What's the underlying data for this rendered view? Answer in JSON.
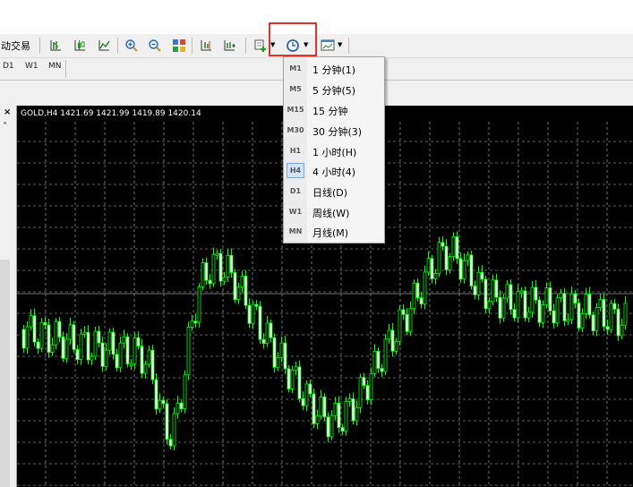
{
  "toolbar": {
    "trade_label": "动交易",
    "period_dropdown_icon": "clock-icon"
  },
  "timeframes_bar": [
    "D1",
    "W1",
    "MN"
  ],
  "chart": {
    "title": "GOLD,H4  1421.69 1421.99 1419.89 1420.14",
    "background": "#000000",
    "candle_color": "#00ff00"
  },
  "period_menu": {
    "items": [
      {
        "code": "M1",
        "label": "1 分钟(1)"
      },
      {
        "code": "M5",
        "label": "5 分钟(5)"
      },
      {
        "code": "M15",
        "label": "15 分钟"
      },
      {
        "code": "M30",
        "label": "30 分钟(3)"
      },
      {
        "code": "H1",
        "label": "1 小时(H)"
      },
      {
        "code": "H4",
        "label": "4 小时(4)"
      },
      {
        "code": "D1",
        "label": "日线(D)"
      },
      {
        "code": "W1",
        "label": "周线(W)"
      },
      {
        "code": "MN",
        "label": "月线(M)"
      }
    ],
    "selected_index": 5
  },
  "highlight_color": "#e0332f"
}
